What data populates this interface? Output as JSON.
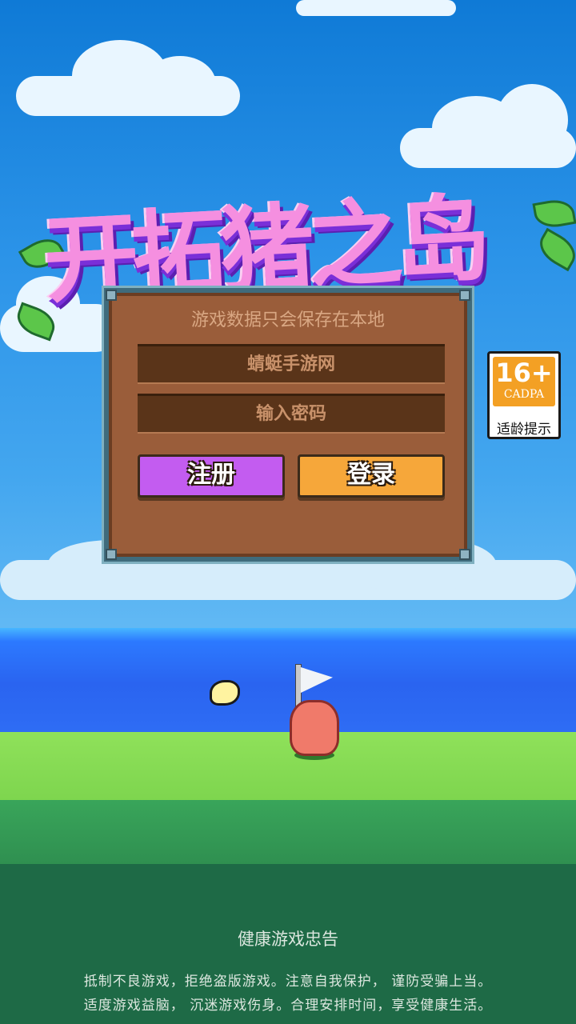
{
  "game": {
    "title": "开拓猪之岛"
  },
  "login_panel": {
    "note": "游戏数据只会保存在本地",
    "username_value": "蜻蜓手游网",
    "password_placeholder": "输入密码",
    "register_label": "注册",
    "login_label": "登录"
  },
  "age_rating": {
    "age": "16+",
    "org": "CADPA",
    "tip": "适龄提示"
  },
  "health_notice": {
    "title": "健康游戏忠告",
    "line1": "抵制不良游戏，拒绝盗版游戏。注意自我保护， 谨防受骗上当。",
    "line2": "适度游戏益脑， 沉迷游戏伤身。合理安排时间，享受健康生活。"
  },
  "colors": {
    "register": "#c35cf0",
    "login": "#f6a73a",
    "panel": "#9a5d3a",
    "age_badge": "#f3a024"
  }
}
